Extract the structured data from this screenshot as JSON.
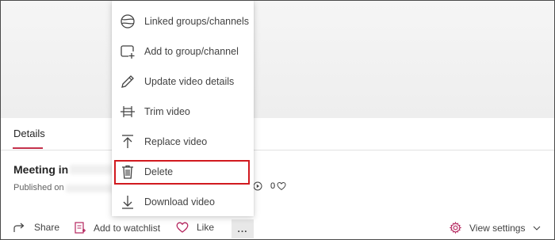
{
  "menu": {
    "items": [
      {
        "label": "Linked groups/channels",
        "icon": "globe-icon"
      },
      {
        "label": "Add to group/channel",
        "icon": "add-to-group-icon"
      },
      {
        "label": "Update video details",
        "icon": "pencil-icon"
      },
      {
        "label": "Trim video",
        "icon": "trim-icon"
      },
      {
        "label": "Replace video",
        "icon": "upload-arrow-icon"
      },
      {
        "label": "Delete",
        "icon": "trash-icon"
      },
      {
        "label": "Download video",
        "icon": "download-icon"
      }
    ],
    "highlighted": "Delete",
    "highlight_color": "#d1191f"
  },
  "details": {
    "tab_label": "Details",
    "tab_accent": "#c4314b",
    "title": "Meeting in",
    "published": "Published on",
    "views": "0",
    "likes": "0"
  },
  "actions": {
    "share": "Share",
    "add_to_watchlist": "Add to watchlist",
    "like": "Like",
    "more": "...",
    "view_settings": "View settings"
  }
}
